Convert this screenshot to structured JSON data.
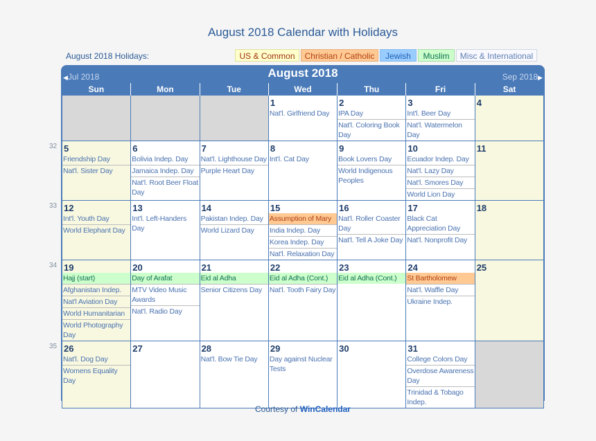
{
  "title": "August 2018 Calendar with Holidays",
  "holidays_label": "August 2018 Holidays:",
  "legend": [
    {
      "label": "US & Common",
      "key": "us"
    },
    {
      "label": "Christian / Catholic",
      "key": "christian"
    },
    {
      "label": "Jewish",
      "key": "jewish"
    },
    {
      "label": "Muslim",
      "key": "muslim"
    },
    {
      "label": "Misc & International",
      "key": "misc"
    }
  ],
  "calendar": {
    "month_title": "August 2018",
    "prev_label": "Jul 2018",
    "next_label": "Sep 2018",
    "weekdays": [
      "Sun",
      "Mon",
      "Tue",
      "Wed",
      "Thu",
      "Fri",
      "Sat"
    ],
    "weeks": [
      {
        "week_no": "",
        "days": [
          {
            "day": "",
            "events": []
          },
          {
            "day": "",
            "events": []
          },
          {
            "day": "",
            "events": []
          },
          {
            "day": "1",
            "events": [
              {
                "text": "Nat'l. Girlfriend Day",
                "type": "misc"
              }
            ]
          },
          {
            "day": "2",
            "events": [
              {
                "text": "IPA Day",
                "type": "misc"
              },
              {
                "text": "Nat'l. Coloring Book Day",
                "type": "misc"
              }
            ]
          },
          {
            "day": "3",
            "events": [
              {
                "text": "Int'l. Beer Day",
                "type": "misc"
              },
              {
                "text": "Nat'l. Watermelon Day",
                "type": "misc"
              }
            ]
          },
          {
            "day": "4",
            "events": []
          }
        ]
      },
      {
        "week_no": "32",
        "days": [
          {
            "day": "5",
            "events": [
              {
                "text": "Friendship Day",
                "type": "misc"
              },
              {
                "text": "Nat'l. Sister Day",
                "type": "misc"
              }
            ]
          },
          {
            "day": "6",
            "events": [
              {
                "text": "Bolivia Indep. Day",
                "type": "misc"
              },
              {
                "text": "Jamaica Indep. Day",
                "type": "misc"
              },
              {
                "text": "Nat'l. Root Beer Float Day",
                "type": "misc"
              }
            ]
          },
          {
            "day": "7",
            "events": [
              {
                "text": "Nat'l. Lighthouse Day",
                "type": "misc"
              },
              {
                "text": "Purple Heart Day",
                "type": "misc"
              }
            ]
          },
          {
            "day": "8",
            "events": [
              {
                "text": "Int'l. Cat Day",
                "type": "misc"
              }
            ]
          },
          {
            "day": "9",
            "events": [
              {
                "text": "Book Lovers Day",
                "type": "misc"
              },
              {
                "text": "World Indigenous Peoples",
                "type": "misc"
              }
            ]
          },
          {
            "day": "10",
            "events": [
              {
                "text": "Ecuador Indep. Day",
                "type": "misc"
              },
              {
                "text": "Nat'l. Lazy Day",
                "type": "misc"
              },
              {
                "text": "Nat'l. Smores Day",
                "type": "misc"
              },
              {
                "text": "World Lion Day",
                "type": "misc"
              }
            ]
          },
          {
            "day": "11",
            "events": []
          }
        ]
      },
      {
        "week_no": "33",
        "days": [
          {
            "day": "12",
            "events": [
              {
                "text": "Int'l. Youth Day",
                "type": "misc"
              },
              {
                "text": "World Elephant Day",
                "type": "misc"
              }
            ]
          },
          {
            "day": "13",
            "events": [
              {
                "text": "Int'l. Left-Handers Day",
                "type": "misc"
              }
            ]
          },
          {
            "day": "14",
            "events": [
              {
                "text": "Pakistan Indep. Day",
                "type": "misc"
              },
              {
                "text": "World Lizard Day",
                "type": "misc"
              }
            ]
          },
          {
            "day": "15",
            "events": [
              {
                "text": "Assumption of Mary",
                "type": "christian"
              },
              {
                "text": "India Indep. Day",
                "type": "misc"
              },
              {
                "text": "Korea Indep. Day",
                "type": "misc"
              },
              {
                "text": "Nat'l. Relaxation Day",
                "type": "misc"
              }
            ]
          },
          {
            "day": "16",
            "events": [
              {
                "text": "Nat'l. Roller Coaster Day",
                "type": "misc"
              },
              {
                "text": "Nat'l. Tell A Joke Day",
                "type": "misc"
              }
            ]
          },
          {
            "day": "17",
            "events": [
              {
                "text": "Black Cat Appreciation Day",
                "type": "misc"
              },
              {
                "text": "Nat'l. Nonprofit Day",
                "type": "misc"
              }
            ]
          },
          {
            "day": "18",
            "events": []
          }
        ]
      },
      {
        "week_no": "34",
        "days": [
          {
            "day": "19",
            "events": [
              {
                "text": "Hajj (start)",
                "type": "muslim"
              },
              {
                "text": "Afghanistan Indep.",
                "type": "misc"
              },
              {
                "text": "Nat'l Aviation Day",
                "type": "misc"
              },
              {
                "text": "World Humanitarian",
                "type": "misc"
              },
              {
                "text": "World Photography Day",
                "type": "misc"
              }
            ]
          },
          {
            "day": "20",
            "events": [
              {
                "text": "Day of Arafat",
                "type": "muslim"
              },
              {
                "text": "MTV Video Music Awards",
                "type": "misc"
              },
              {
                "text": "Nat'l. Radio Day",
                "type": "misc"
              }
            ]
          },
          {
            "day": "21",
            "events": [
              {
                "text": "Eid al Adha",
                "type": "muslim"
              },
              {
                "text": "Senior Citizens Day",
                "type": "misc"
              }
            ]
          },
          {
            "day": "22",
            "events": [
              {
                "text": "Eid al Adha (Cont.)",
                "type": "muslim"
              },
              {
                "text": "Nat'l. Tooth Fairy Day",
                "type": "misc"
              }
            ]
          },
          {
            "day": "23",
            "events": [
              {
                "text": "Eid al Adha (Cont.)",
                "type": "muslim"
              }
            ]
          },
          {
            "day": "24",
            "events": [
              {
                "text": "St Bartholomew",
                "type": "christian"
              },
              {
                "text": "Nat'l. Waffle Day",
                "type": "misc"
              },
              {
                "text": "Ukraine Indep.",
                "type": "misc"
              }
            ]
          },
          {
            "day": "25",
            "events": []
          }
        ]
      },
      {
        "week_no": "35",
        "days": [
          {
            "day": "26",
            "events": [
              {
                "text": "Nat'l. Dog Day",
                "type": "misc"
              },
              {
                "text": "Womens Equality Day",
                "type": "misc"
              }
            ]
          },
          {
            "day": "27",
            "events": []
          },
          {
            "day": "28",
            "events": [
              {
                "text": "Nat'l. Bow Tie Day",
                "type": "misc"
              }
            ]
          },
          {
            "day": "29",
            "events": [
              {
                "text": "Day against Nuclear Tests",
                "type": "misc"
              }
            ]
          },
          {
            "day": "30",
            "events": []
          },
          {
            "day": "31",
            "events": [
              {
                "text": "College Colors Day",
                "type": "misc"
              },
              {
                "text": "Overdose Awareness Day",
                "type": "misc"
              },
              {
                "text": "Trinidad & Tobago Indep.",
                "type": "misc"
              }
            ]
          },
          {
            "day": "",
            "events": []
          }
        ]
      }
    ]
  },
  "footer": {
    "prefix": "Courtesy of",
    "link": "WinCalendar"
  }
}
